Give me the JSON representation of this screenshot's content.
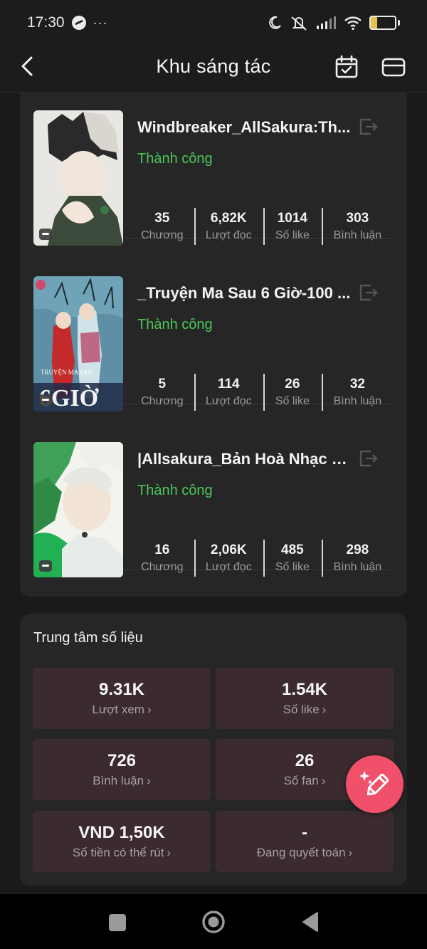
{
  "status_bar": {
    "time": "17:30",
    "more": "···",
    "battery": "27",
    "icons": [
      "messenger-icon",
      "moon-icon",
      "mute-icon",
      "signal-icon",
      "wifi-icon",
      "battery-icon"
    ]
  },
  "header": {
    "title": "Khu sáng tác",
    "icons": [
      "back-icon",
      "calendar-icon",
      "mail-icon"
    ]
  },
  "works": [
    {
      "title": "Windbreaker_AllSakura:Th...",
      "status": "Thành công",
      "stats": [
        {
          "value": "35",
          "label": "Chương"
        },
        {
          "value": "6,82K",
          "label": "Lượt đọc"
        },
        {
          "value": "1014",
          "label": "Số like"
        },
        {
          "value": "303",
          "label": "Bình luận"
        }
      ]
    },
    {
      "title": "_Truyện Ma Sau 6 Giờ-100 ...",
      "status": "Thành công",
      "cover_text": "6GIỜ",
      "stats": [
        {
          "value": "5",
          "label": "Chương"
        },
        {
          "value": "114",
          "label": "Lượt đọc"
        },
        {
          "value": "26",
          "label": "Số like"
        },
        {
          "value": "32",
          "label": "Bình luận"
        }
      ]
    },
    {
      "title": "|Allsakura_Bản Hoà Nhạc Ở...",
      "status": "Thành công",
      "stats": [
        {
          "value": "16",
          "label": "Chương"
        },
        {
          "value": "2,06K",
          "label": "Lượt đọc"
        },
        {
          "value": "485",
          "label": "Số like"
        },
        {
          "value": "298",
          "label": "Bình luận"
        }
      ]
    }
  ],
  "data_center": {
    "title": "Trung tâm số liệu",
    "tiles": [
      {
        "value": "9.31K",
        "label": "Lượt xem"
      },
      {
        "value": "1.54K",
        "label": "Số like"
      },
      {
        "value": "726",
        "label": "Bình luận"
      },
      {
        "value": "26",
        "label": "Số fan"
      },
      {
        "value": "VND 1,50K",
        "label": "Số tiền có thể rút"
      },
      {
        "value": "-",
        "label": "Đang quyết toán"
      }
    ],
    "chevron": "›"
  },
  "colors": {
    "background": "#1a1a1a",
    "card": "#262626",
    "tile": "#3b2a2e",
    "success": "#4cc65a",
    "fab": "#f0506a",
    "battery": "#e8c24a"
  }
}
